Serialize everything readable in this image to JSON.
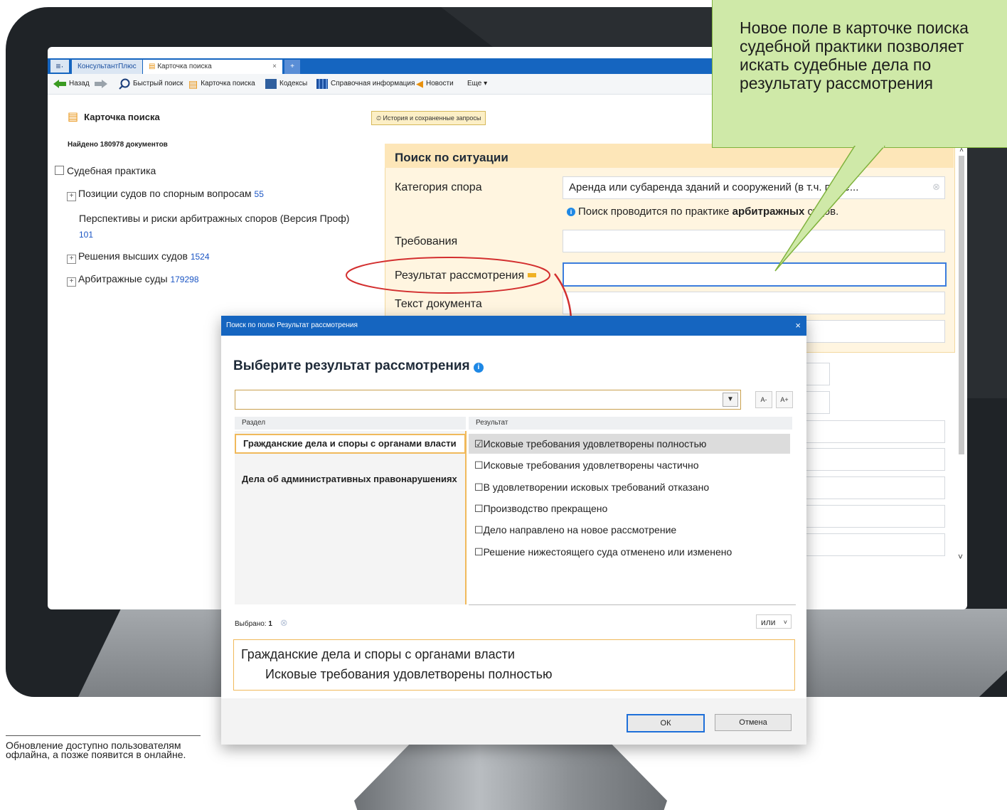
{
  "app": {
    "brand_tab": "КонсультантПлюс",
    "active_tab": "Карточка поиска",
    "tab_close": "×",
    "tab_add": "+"
  },
  "toolbar": {
    "back": "Назад",
    "quick_search": "Быстрый поиск",
    "search_card": "Карточка поиска",
    "codes": "Кодексы",
    "reference": "Справочная информация",
    "news": "Новости",
    "more": "Еще ▾"
  },
  "left_panel": {
    "title": "Карточка поиска",
    "found": "Найдено 180978 документов",
    "root": "Судебная практика",
    "items": [
      {
        "label": "Позиции судов по спорным вопросам",
        "count": "55"
      },
      {
        "label": "Перспективы и риски арбитражных споров (Версия Проф)",
        "count": "101"
      },
      {
        "label": "Решения высших судов",
        "count": "1524"
      },
      {
        "label": "Арбитражные суды",
        "count": "179298"
      }
    ]
  },
  "history_button": "История и сохраненные запросы",
  "situation": {
    "title": "Поиск по ситуации",
    "category_label": "Категория спора",
    "category_value": "Аренда или субаренда зданий и сооружений (в т.ч. поме...",
    "note_prefix": "Поиск проводится по практике ",
    "note_bold": "арбитражных",
    "note_suffix": " судов.",
    "requirements_label": "Требования",
    "result_label": "Результат рассмотрения",
    "text_label": "Текст документа"
  },
  "callout": "Новое поле в карточке поиска судебной практики позволяет искать судебные дела по результату рассмотрения",
  "dialog": {
    "title": "Поиск по полю Результат рассмотрения",
    "close": "×",
    "heading": "Выберите результат рассмотрения",
    "font_minus": "A-",
    "font_plus": "A+",
    "col_section": "Раздел",
    "col_result": "Результат",
    "sections": [
      "Гражданские дела и споры с органами власти",
      "Дела об административных правонарушениях"
    ],
    "results": [
      {
        "label": "Исковые требования удовлетворены полностью",
        "checked": "☑"
      },
      {
        "label": "Исковые требования удовлетворены частично",
        "checked": "☐"
      },
      {
        "label": "В удовлетворении исковых требований отказано",
        "checked": "☐"
      },
      {
        "label": "Производство прекращено",
        "checked": "☐"
      },
      {
        "label": "Дело направлено на новое рассмотрение",
        "checked": "☐"
      },
      {
        "label": "Решение нижестоящего суда отменено или изменено",
        "checked": "☐"
      }
    ],
    "selected_label": "Выбрано: ",
    "selected_count": "1",
    "or_select": "или",
    "summary_section": "Гражданские дела и споры с органами власти",
    "summary_result": "Исковые требования удовлетворены полностью",
    "ok": "ОК",
    "cancel": "Отмена"
  },
  "footnote": "Обновление доступно пользователям офлайна, а позже появится в онлайне.",
  "colors": {
    "titlebar": "#1565c0",
    "accent_orange": "#f0b95b",
    "callout_green": "#cfe9a8",
    "annotation_red": "#d32f2f"
  }
}
